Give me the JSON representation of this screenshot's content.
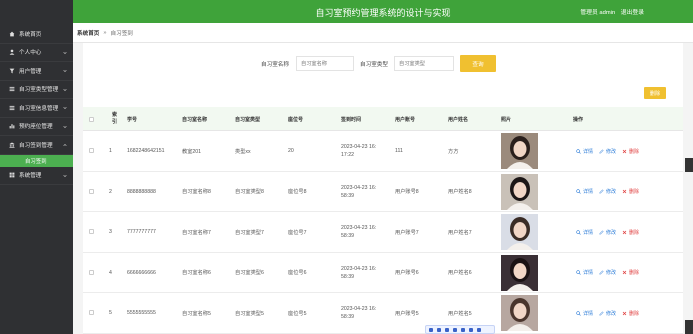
{
  "app": {
    "title": "自习室预约管理系统的设计与实现",
    "user_label": "管理员 admin",
    "logout_label": "退出登录"
  },
  "sidebar": {
    "items": [
      {
        "label": "系统首页",
        "icon": "home-icon",
        "has_children": false
      },
      {
        "label": "个人中心",
        "icon": "user-icon",
        "has_children": true
      },
      {
        "label": "用户管理",
        "icon": "filter-icon",
        "has_children": true
      },
      {
        "label": "自习室类型管理",
        "icon": "list-icon",
        "has_children": true
      },
      {
        "label": "自习室信息管理",
        "icon": "list-icon",
        "has_children": true
      },
      {
        "label": "预约座位管理",
        "icon": "chart-icon",
        "has_children": true
      },
      {
        "label": "自习签到管理",
        "icon": "bank-icon",
        "has_children": true,
        "expanded": true
      },
      {
        "label": "系统管理",
        "icon": "grid-icon",
        "has_children": true
      }
    ],
    "active_sub": "自习签到"
  },
  "breadcrumb": {
    "home": "系统首页",
    "separator": "»",
    "current": "自习签到"
  },
  "search": {
    "name_label": "自习室名称",
    "name_placeholder": "自习室名称",
    "type_label": "自习室类型",
    "type_placeholder": "自习室类型",
    "query_label": "查询"
  },
  "toolbar": {
    "delete_label": "删除"
  },
  "table": {
    "headers": {
      "index": "索引",
      "student_no": "学号",
      "room_name": "自习室名称",
      "room_type": "自习室类型",
      "seat_no": "座位号",
      "sign_time": "签到时间",
      "user_account": "用户账号",
      "user_name": "用户姓名",
      "photo": "照片",
      "actions": "操作"
    },
    "rows": [
      {
        "index": "1",
        "student_no": "1682248642151",
        "room_name": "教室201",
        "room_type": "类型xx",
        "seat_no": "20",
        "date": "2023-04-23 16:",
        "time": "17:22",
        "user_account": "111",
        "user_name": "方方",
        "photo": "portrait-1"
      },
      {
        "index": "2",
        "student_no": "8888888888",
        "room_name": "自习室名称8",
        "room_type": "自习室类型8",
        "seat_no": "座位号8",
        "date": "2023-04-23 16:",
        "time": "58:39",
        "user_account": "用户账号8",
        "user_name": "用户姓名8",
        "photo": "portrait-2"
      },
      {
        "index": "3",
        "student_no": "7777777777",
        "room_name": "自习室名称7",
        "room_type": "自习室类型7",
        "seat_no": "座位号7",
        "date": "2023-04-23 16:",
        "time": "58:39",
        "user_account": "用户账号7",
        "user_name": "用户姓名7",
        "photo": "portrait-3"
      },
      {
        "index": "4",
        "student_no": "6666666666",
        "room_name": "自习室名称6",
        "room_type": "自习室类型6",
        "seat_no": "座位号6",
        "date": "2023-04-23 16:",
        "time": "58:39",
        "user_account": "用户账号6",
        "user_name": "用户姓名6",
        "photo": "portrait-4"
      },
      {
        "index": "5",
        "student_no": "5555555555",
        "room_name": "自习室名称5",
        "room_type": "自习室类型5",
        "seat_no": "座位号5",
        "date": "2023-04-23 16:",
        "time": "58:39",
        "user_account": "用户账号5",
        "user_name": "用户姓名5",
        "photo": "portrait-5"
      }
    ],
    "action_labels": {
      "view": "详情",
      "edit": "修改",
      "delete": "删除"
    }
  },
  "colors": {
    "header_green": "#3fa33a",
    "sidebar_dark": "#2f3033",
    "button_yellow": "#f0c030",
    "link_blue": "#2f7ed8",
    "danger_red": "#e04040"
  }
}
